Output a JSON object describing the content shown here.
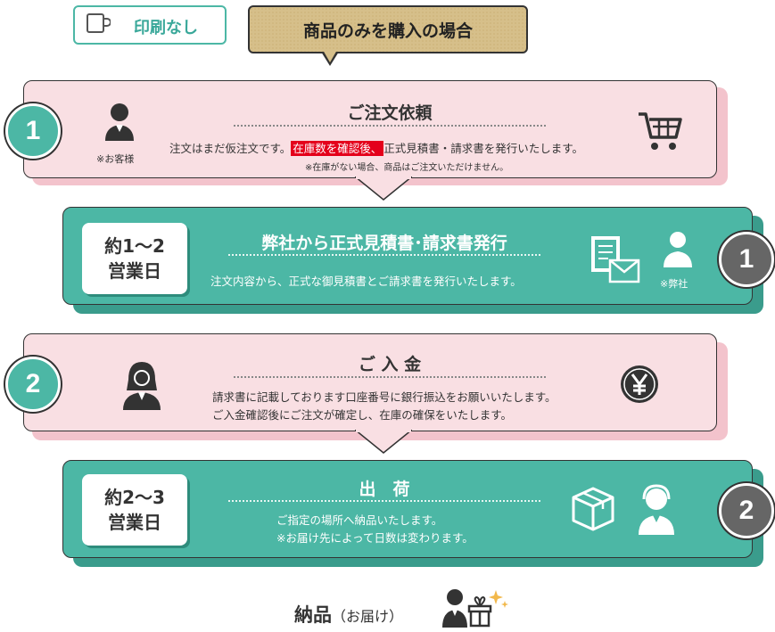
{
  "header": {
    "no_print_label": "印刷なし",
    "bubble_text": "商品のみを購入の場合"
  },
  "steps": {
    "order": {
      "number": "1",
      "title": "ご注文依頼",
      "text_before": "注文はまだ仮注文です。",
      "highlight": "在庫数を確認後、",
      "text_after": "正式見積書・請求書を発行いたします。",
      "note": "※在庫がない場合、商品はご注文いただけません。",
      "actor": "※お客様",
      "icon": "shopping-cart-icon"
    },
    "invoice": {
      "number": "1",
      "days_line1": "約1〜2",
      "days_line2": "営業日",
      "title": "弊社から正式見積書･請求書発行",
      "text": "注文内容から、正式な御見積書とご請求書を発行いたします。",
      "actor": "※弊社",
      "icon": "document-mail-icon"
    },
    "payment": {
      "number": "2",
      "title": "ご 入 金",
      "line1": "請求書に記載しております口座番号に銀行振込をお願いいたします。",
      "line2": "ご入金確認後にご注文が確定し、在庫の確保をいたします。",
      "icon": "yen-coin-icon"
    },
    "shipping": {
      "number": "2",
      "days_line1": "約2〜3",
      "days_line2": "営業日",
      "title": "出　荷",
      "line1": "ご指定の場所へ納品いたします。",
      "line2": "※お届け先によって日数は変わります。",
      "icon": "box-icon"
    }
  },
  "delivery": {
    "main": "納品",
    "sub": "（お届け）"
  },
  "colors": {
    "pink": "#f9dfe3",
    "green": "#4cb7a5",
    "highlight_red": "#e4001b",
    "gray_circle": "#666666"
  }
}
